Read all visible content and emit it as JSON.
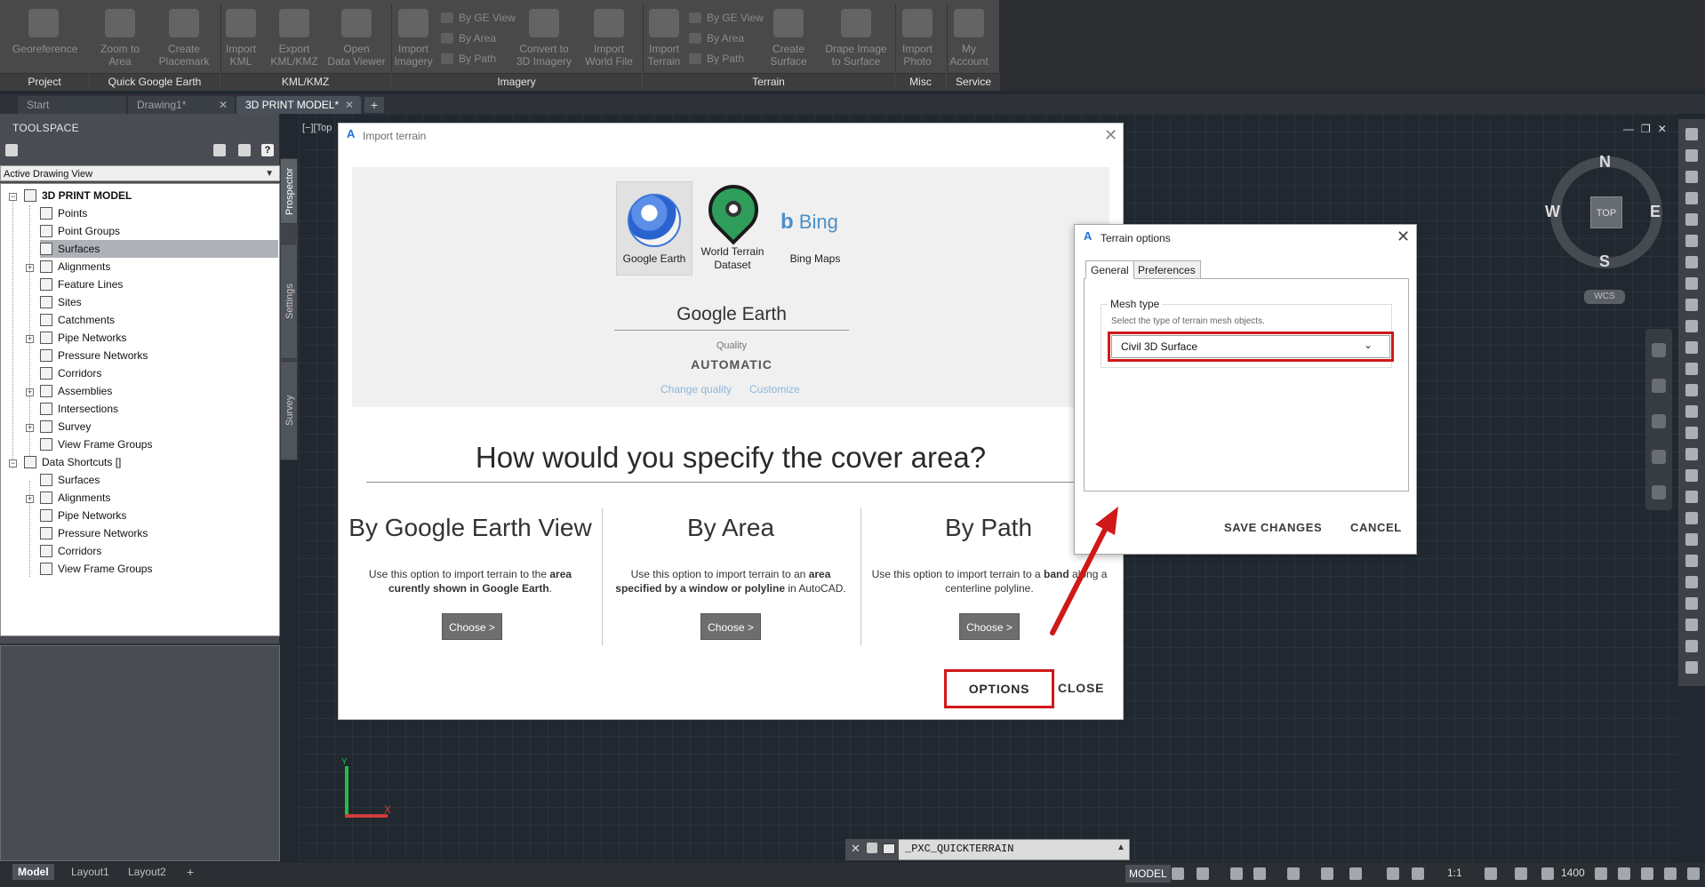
{
  "ribbon": {
    "buttons": [
      {
        "label": "Georeference"
      },
      {
        "label": "Zoom to\nArea"
      },
      {
        "label": "Create\nPlacemark"
      },
      {
        "label": "Import\nKML"
      },
      {
        "label": "Export\nKML/KMZ"
      },
      {
        "label": "Open\nData Viewer"
      },
      {
        "label": "Import\nImagery"
      },
      {
        "label": "Convert to\n3D Imagery"
      },
      {
        "label": "Import\nWorld File"
      },
      {
        "label": "Import\nTerrain"
      },
      {
        "label": "Create\nSurface"
      },
      {
        "label": "Drape Image\nto Surface"
      },
      {
        "label": "Import\nPhoto"
      },
      {
        "label": "My\nAccount"
      }
    ],
    "small_imagery": [
      "By GE View",
      "By Area",
      "By Path"
    ],
    "small_terrain": [
      "By GE View",
      "By Area",
      "By Path"
    ],
    "groups": [
      "Project",
      "Quick Google Earth",
      "KML/KMZ",
      "Imagery",
      "Terrain",
      "Misc",
      "Service"
    ]
  },
  "file_tabs": [
    {
      "label": "Start"
    },
    {
      "label": "Drawing1*"
    },
    {
      "label": "3D PRINT MODEL*"
    }
  ],
  "toolspace": {
    "title": "TOOLSPACE",
    "view_select": "Active Drawing View",
    "tree": [
      {
        "label": "3D PRINT MODEL"
      },
      {
        "label": "Points"
      },
      {
        "label": "Point Groups"
      },
      {
        "label": "Surfaces"
      },
      {
        "label": "Alignments"
      },
      {
        "label": "Feature Lines"
      },
      {
        "label": "Sites"
      },
      {
        "label": "Catchments"
      },
      {
        "label": "Pipe Networks"
      },
      {
        "label": "Pressure Networks"
      },
      {
        "label": "Corridors"
      },
      {
        "label": "Assemblies"
      },
      {
        "label": "Intersections"
      },
      {
        "label": "Survey"
      },
      {
        "label": "View Frame Groups"
      },
      {
        "label": "Data Shortcuts []"
      },
      {
        "label": "Surfaces"
      },
      {
        "label": "Alignments"
      },
      {
        "label": "Pipe Networks"
      },
      {
        "label": "Pressure Networks"
      },
      {
        "label": "Corridors"
      },
      {
        "label": "View Frame Groups"
      }
    ],
    "side_tabs": [
      "Prospector",
      "Settings",
      "Survey"
    ]
  },
  "viewport": {
    "label": "[−][Top",
    "window_controls": "—❐✕",
    "viewcube": {
      "top": "TOP",
      "n": "N",
      "s": "S",
      "e": "E",
      "w": "W",
      "wcs": "WCS"
    },
    "ucs": {
      "x": "X",
      "y": "Y"
    }
  },
  "import_dialog": {
    "title": "Import terrain",
    "providers": [
      {
        "label": "Google Earth"
      },
      {
        "label": "World Terrain\nDataset"
      },
      {
        "label": "Bing Maps"
      }
    ],
    "bing_logo": "Bing",
    "selected_provider": "Google Earth",
    "quality_label": "Quality",
    "quality_value": "AUTOMATIC",
    "change_quality": "Change quality",
    "customize": "Customize",
    "cover_heading": "How would you specify the cover area?",
    "options": [
      {
        "title": "By Google Earth View",
        "desc_pre": "Use this option to import terrain to the ",
        "desc_bold": "area curently shown in Google Earth",
        "desc_post": ".",
        "button": "Choose >"
      },
      {
        "title": "By Area",
        "desc_pre": "Use this option to import terrain to an ",
        "desc_bold": "area specified by a window or polyline",
        "desc_post": " in AutoCAD.",
        "button": "Choose >"
      },
      {
        "title": "By Path",
        "desc_pre": "Use this option to import terrain to a ",
        "desc_bold": "band",
        "desc_post": " along a centerline polyline.",
        "button": "Choose >"
      }
    ],
    "options_button": "OPTIONS",
    "close_button": "CLOSE"
  },
  "terrain_options": {
    "title": "Terrain options",
    "tabs": [
      "General",
      "Preferences"
    ],
    "mesh_type_label": "Mesh type",
    "mesh_type_hint": "Select the type of terrain mesh objects.",
    "mesh_type_value": "Civil 3D Surface",
    "save_button": "SAVE CHANGES",
    "cancel_button": "CANCEL"
  },
  "command_line": {
    "text": "_PXC_QUICKTERRAIN"
  },
  "status": {
    "layout_tabs": [
      "Model",
      "Layout1",
      "Layout2"
    ],
    "model_button": "MODEL",
    "scale": "1:1",
    "number": "1400"
  },
  "colors": {
    "highlight": "#d01818",
    "autodesk_blue": "#1e73d6"
  }
}
